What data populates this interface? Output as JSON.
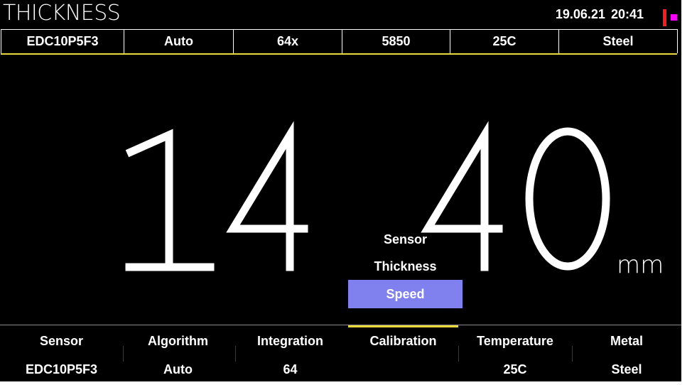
{
  "header": {
    "title": "THICKNESS",
    "date": "19.06.21",
    "time": "20:41"
  },
  "status_bar": [
    "EDC10P5F3",
    "Auto",
    "64x",
    "5850",
    "25C",
    "Steel"
  ],
  "reading": {
    "value": "14.40",
    "unit": "mm"
  },
  "popup_menu": {
    "items": [
      "Sensor",
      "Thickness",
      "Speed"
    ],
    "selected": "Speed"
  },
  "bottom_menu": [
    {
      "label": "Sensor",
      "value": "EDC10P5F3"
    },
    {
      "label": "Algorithm",
      "value": "Auto"
    },
    {
      "label": "Integration",
      "value": "64"
    },
    {
      "label": "Calibration",
      "value": ""
    },
    {
      "label": "Temperature",
      "value": "25C"
    },
    {
      "label": "Metal",
      "value": "Steel"
    }
  ],
  "colors": {
    "background": "#000000",
    "accent_yellow": "#e8d83a",
    "selected_item": "#8080ee",
    "flag_red": "#ff1a1a",
    "flag_magenta": "#ff00ff"
  },
  "icons": {
    "status_flag": "flag-icon"
  }
}
